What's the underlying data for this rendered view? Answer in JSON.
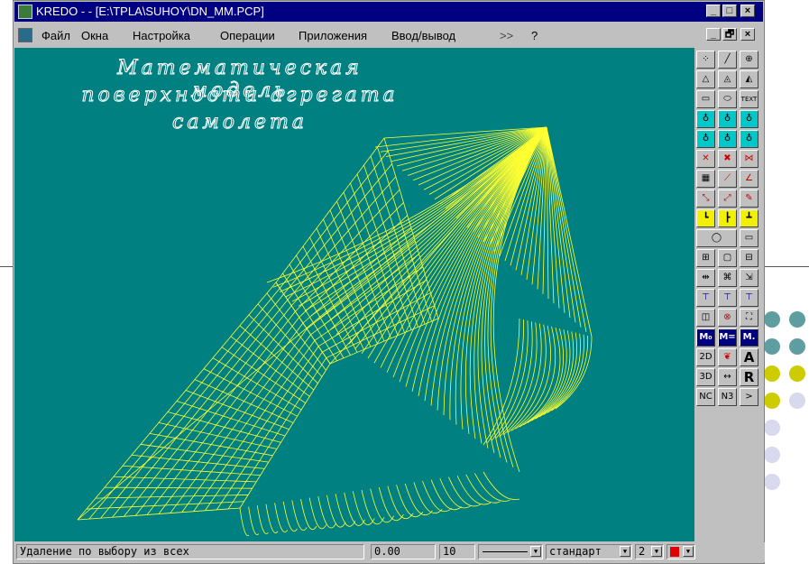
{
  "window": {
    "title": "KREDO - - [E:\\TPLA\\SUHOY\\DN_MM.PCP]",
    "controls": {
      "minimize": "_",
      "maximize": "□",
      "close": "×"
    },
    "mdi_controls": {
      "minimize": "_",
      "restore": "🗗",
      "close": "×"
    }
  },
  "menu": {
    "items": [
      "Файл",
      "Окна",
      "Настройка",
      "Операции",
      "Приложения",
      "Ввод/вывод",
      ">>",
      "?"
    ]
  },
  "canvas": {
    "background": "#008080",
    "wire_color": "#ffff33",
    "headline": [
      "Математическая модель",
      "поверхности агрегата",
      "самолета"
    ]
  },
  "toolbox": {
    "labels": {
      "text_tool": "TEXT",
      "m0": "M₀",
      "m_eq": "M=",
      "m_dot": "M.",
      "a": "A",
      "r": "R",
      "d2": "2D",
      "d3": "3D",
      "nc": "NC",
      "n3": "N3",
      "next": ">"
    }
  },
  "status": {
    "message": "Удаление по выбору из всех",
    "value1": "0.00",
    "value2": "10",
    "style": "стандарт",
    "width": "2"
  },
  "colors": {
    "titlebar": "#000080",
    "face": "#c0c0c0",
    "deco_teal": "#5f9ea0",
    "deco_olive": "#cccc00",
    "deco_lavender": "#d8d8ee"
  }
}
